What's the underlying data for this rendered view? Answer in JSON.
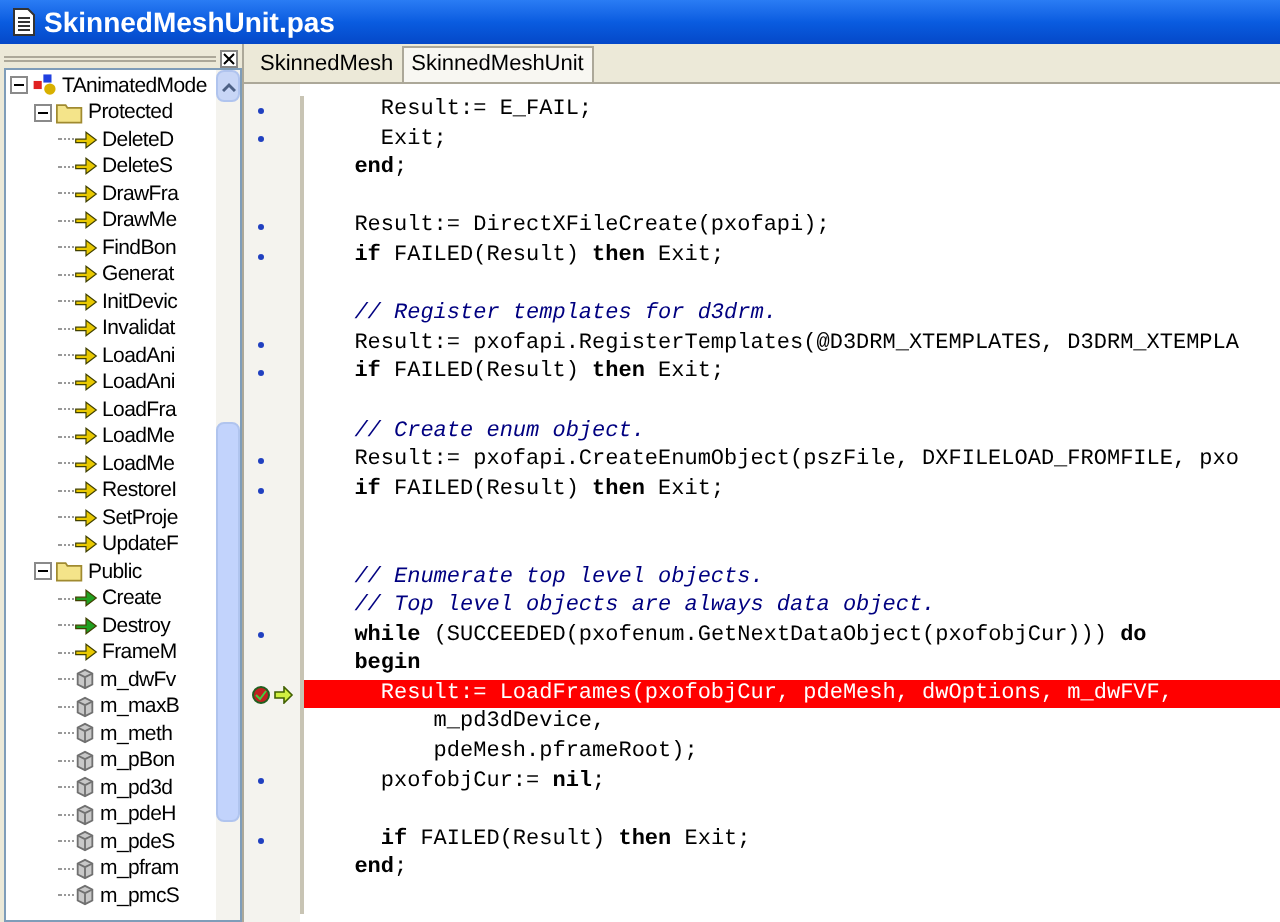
{
  "window": {
    "title": "SkinnedMeshUnit.pas"
  },
  "tree": {
    "items": [
      {
        "label": "TAnimatedMode",
        "kind": "class",
        "expanded": true,
        "children": [
          {
            "label": "Protected",
            "kind": "folder",
            "expanded": true,
            "children": [
              {
                "label": "DeleteD",
                "kind": "method"
              },
              {
                "label": "DeleteS",
                "kind": "method"
              },
              {
                "label": "DrawFra",
                "kind": "method"
              },
              {
                "label": "DrawMe",
                "kind": "method"
              },
              {
                "label": "FindBon",
                "kind": "method"
              },
              {
                "label": "Generat",
                "kind": "method"
              },
              {
                "label": "InitDevic",
                "kind": "method"
              },
              {
                "label": "Invalidat",
                "kind": "method"
              },
              {
                "label": "LoadAni",
                "kind": "method"
              },
              {
                "label": "LoadAni",
                "kind": "method"
              },
              {
                "label": "LoadFra",
                "kind": "method"
              },
              {
                "label": "LoadMe",
                "kind": "method"
              },
              {
                "label": "LoadMe",
                "kind": "method"
              },
              {
                "label": "RestoreI",
                "kind": "method"
              },
              {
                "label": "SetProje",
                "kind": "method"
              },
              {
                "label": "UpdateF",
                "kind": "method"
              }
            ]
          },
          {
            "label": "Public",
            "kind": "folder",
            "expanded": true,
            "children": [
              {
                "label": "Create",
                "kind": "constructor"
              },
              {
                "label": "Destroy",
                "kind": "constructor"
              },
              {
                "label": "FrameM",
                "kind": "method"
              },
              {
                "label": "m_dwFv",
                "kind": "field"
              },
              {
                "label": "m_maxB",
                "kind": "field"
              },
              {
                "label": "m_meth",
                "kind": "field"
              },
              {
                "label": "m_pBon",
                "kind": "field"
              },
              {
                "label": "m_pd3d",
                "kind": "field"
              },
              {
                "label": "m_pdeH",
                "kind": "field"
              },
              {
                "label": "m_pdeS",
                "kind": "field"
              },
              {
                "label": "m_pfram",
                "kind": "field"
              },
              {
                "label": "m_pmcS",
                "kind": "field"
              }
            ]
          }
        ]
      }
    ]
  },
  "tabs": [
    {
      "label": "SkinnedMesh",
      "selected": false
    },
    {
      "label": "SkinnedMeshUnit",
      "selected": true
    }
  ],
  "code": {
    "lines": [
      {
        "kind": "executable",
        "segments": [
          {
            "text": "    Result:= E_FAIL;",
            "kind": "normal"
          }
        ]
      },
      {
        "kind": "executable",
        "segments": [
          {
            "text": "    Exit;",
            "kind": "normal"
          }
        ]
      },
      {
        "kind": "plain",
        "segments": [
          {
            "text": "  end",
            "kind": "keyword"
          },
          {
            "text": ";",
            "kind": "normal"
          }
        ]
      },
      {
        "kind": "plain"
      },
      {
        "kind": "executable",
        "segments": [
          {
            "text": "  Result:= DirectXFileCreate(pxofapi);",
            "kind": "normal"
          }
        ]
      },
      {
        "kind": "executable",
        "segments": [
          {
            "text": "  if",
            "kind": "keyword"
          },
          {
            "text": " FAILED(Result) ",
            "kind": "normal"
          },
          {
            "text": "then",
            "kind": "keyword"
          },
          {
            "text": " Exit;",
            "kind": "normal"
          }
        ]
      },
      {
        "kind": "plain"
      },
      {
        "kind": "plain",
        "segments": [
          {
            "text": "  // Register templates for d3drm.",
            "kind": "comment"
          }
        ]
      },
      {
        "kind": "executable",
        "segments": [
          {
            "text": "  Result:= pxofapi.RegisterTemplates(@D3DRM_XTEMPLATES, D3DRM_XTEMPLA",
            "kind": "normal"
          }
        ]
      },
      {
        "kind": "executable",
        "segments": [
          {
            "text": "  if",
            "kind": "keyword"
          },
          {
            "text": " FAILED(Result) ",
            "kind": "normal"
          },
          {
            "text": "then",
            "kind": "keyword"
          },
          {
            "text": " Exit;",
            "kind": "normal"
          }
        ]
      },
      {
        "kind": "plain"
      },
      {
        "kind": "plain",
        "segments": [
          {
            "text": "  // Create enum object.",
            "kind": "comment"
          }
        ]
      },
      {
        "kind": "executable",
        "segments": [
          {
            "text": "  Result:= pxofapi.CreateEnumObject(pszFile, DXFILELOAD_FROMFILE, pxo",
            "kind": "normal"
          }
        ]
      },
      {
        "kind": "executable",
        "segments": [
          {
            "text": "  if",
            "kind": "keyword"
          },
          {
            "text": " FAILED(Result) ",
            "kind": "normal"
          },
          {
            "text": "then",
            "kind": "keyword"
          },
          {
            "text": " Exit;",
            "kind": "normal"
          }
        ]
      },
      {
        "kind": "plain"
      },
      {
        "kind": "plain"
      },
      {
        "kind": "plain",
        "segments": [
          {
            "text": "  // Enumerate top level objects.",
            "kind": "comment"
          }
        ]
      },
      {
        "kind": "plain",
        "segments": [
          {
            "text": "  // Top level objects are always data object.",
            "kind": "comment"
          }
        ]
      },
      {
        "kind": "executable",
        "segments": [
          {
            "text": "  while",
            "kind": "keyword"
          },
          {
            "text": " (SUCCEEDED(pxofenum.GetNextDataObject(pxofobjCur))) ",
            "kind": "normal"
          },
          {
            "text": "do",
            "kind": "keyword"
          }
        ]
      },
      {
        "kind": "plain",
        "segments": [
          {
            "text": "  begin",
            "kind": "keyword"
          }
        ]
      },
      {
        "kind": "current",
        "segments": [
          {
            "text": "    Result:= LoadFrames(pxofobjCur, pdeMesh, dwOptions, m_dwFVF,",
            "kind": "normal"
          }
        ]
      },
      {
        "kind": "plain",
        "segments": [
          {
            "text": "        m_pd3dDevice,",
            "kind": "normal"
          }
        ]
      },
      {
        "kind": "plain",
        "segments": [
          {
            "text": "        pdeMesh.pframeRoot);",
            "kind": "normal"
          }
        ]
      },
      {
        "kind": "executable",
        "segments": [
          {
            "text": "    pxofobjCur:= ",
            "kind": "normal"
          },
          {
            "text": "nil",
            "kind": "keyword"
          },
          {
            "text": ";",
            "kind": "normal"
          }
        ]
      },
      {
        "kind": "plain"
      },
      {
        "kind": "executable",
        "segments": [
          {
            "text": "    if",
            "kind": "keyword"
          },
          {
            "text": " FAILED(Result) ",
            "kind": "normal"
          },
          {
            "text": "then",
            "kind": "keyword"
          },
          {
            "text": " Exit;",
            "kind": "normal"
          }
        ]
      },
      {
        "kind": "plain",
        "segments": [
          {
            "text": "  end",
            "kind": "keyword"
          },
          {
            "text": ";",
            "kind": "normal"
          }
        ]
      },
      {
        "kind": "plain"
      }
    ]
  }
}
